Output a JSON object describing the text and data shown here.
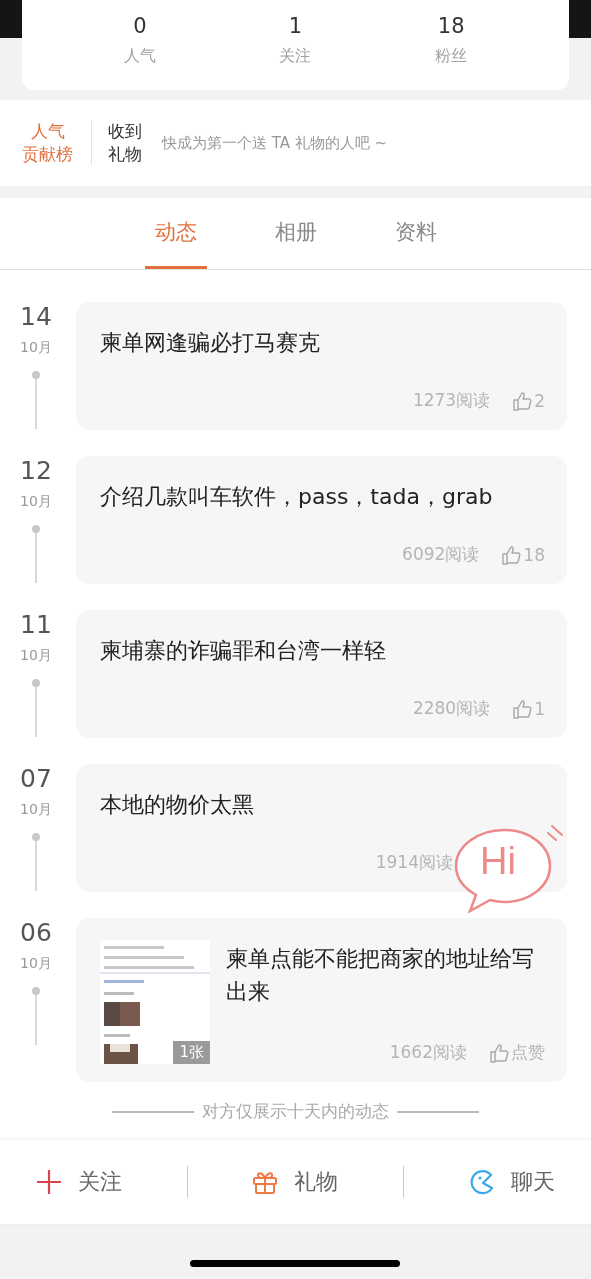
{
  "stats": [
    {
      "value": "0",
      "label": "人气"
    },
    {
      "value": "1",
      "label": "关注"
    },
    {
      "value": "18",
      "label": "粉丝"
    }
  ],
  "gift_bar": {
    "rank_lines": [
      "人气",
      "贡献榜"
    ],
    "gift_lines": [
      "收到",
      "礼物"
    ],
    "prompt": "快成为第一个送 TA 礼物的人吧 ~"
  },
  "tabs": [
    {
      "label": "动态",
      "selected": true
    },
    {
      "label": "相册",
      "selected": false
    },
    {
      "label": "资料",
      "selected": false
    }
  ],
  "posts": [
    {
      "day": "14",
      "month": "10月",
      "title": "柬单网逢骗必打马赛克",
      "reads": "1273阅读",
      "likes": "2"
    },
    {
      "day": "12",
      "month": "10月",
      "title": "介绍几款叫车软件，pass，tada，grab",
      "reads": "6092阅读",
      "likes": "18"
    },
    {
      "day": "11",
      "month": "10月",
      "title": "柬埔寨的诈骗罪和台湾一样轻",
      "reads": "2280阅读",
      "likes": "1"
    },
    {
      "day": "07",
      "month": "10月",
      "title": "本地的物价太黑",
      "reads": "1914阅读"
    },
    {
      "day": "06",
      "month": "10月",
      "title": "柬单点能不能把商家的地址给写出来",
      "reads": "1662阅读",
      "likes": "点赞",
      "image": {
        "kind": "picture",
        "count": "1张"
      }
    }
  ],
  "footer_note": "对方仅展示十天内的动态",
  "chat_bubble": {
    "text": "Hi"
  },
  "actions": [
    {
      "kind": "follow",
      "label": "关注"
    },
    {
      "kind": "gift",
      "label": "礼物"
    },
    {
      "kind": "chat",
      "label": "聊天"
    }
  ]
}
